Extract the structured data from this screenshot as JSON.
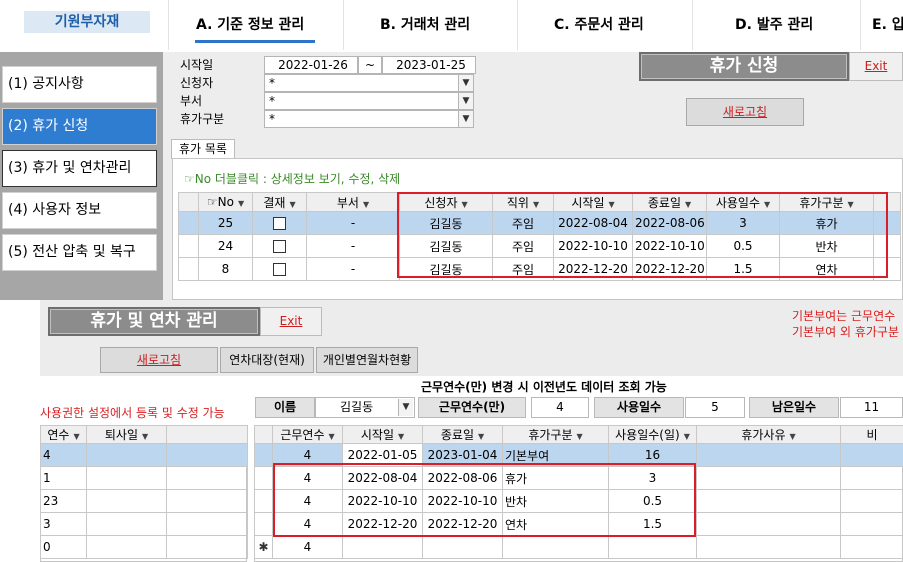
{
  "topnav": {
    "logo": "기원부자재",
    "tabs": [
      {
        "label": "A. 기준 정보 관리"
      },
      {
        "label": "B. 거래처 관리"
      },
      {
        "label": "C. 주문서 관리"
      },
      {
        "label": "D. 발주 관리"
      },
      {
        "label": "E. 입"
      }
    ]
  },
  "sidebar": {
    "items": [
      {
        "label": "(1) 공지사항"
      },
      {
        "label": "(2) 휴가 신청"
      },
      {
        "label": "(3) 휴가 및 연차관리"
      },
      {
        "label": "(4) 사용자 정보"
      },
      {
        "label": "(5) 전산 압축 및 복구"
      }
    ]
  },
  "leave_request": {
    "title": "휴가 신청",
    "exit_label": "Exit",
    "refresh_label": "새로고침",
    "filters": {
      "start_label": "시작일",
      "date_from": "2022-01-26",
      "date_sep": "~",
      "date_to": "2023-01-25",
      "applicant_label": "신청자",
      "applicant_value": "*",
      "dept_label": "부서",
      "dept_value": "*",
      "leave_type_label": "휴가구분",
      "leave_type_value": "*"
    },
    "tab_label": "휴가 목록",
    "hint": "☞No 더블클릭 : 상세정보 보기, 수정, 삭제",
    "columns": [
      "☞No",
      "결재",
      "부서",
      "신청자",
      "직위",
      "시작일",
      "종료일",
      "사용일수",
      "휴가구분"
    ],
    "rows": [
      {
        "no": "25",
        "approval": "",
        "dept": "-",
        "applicant": "김길동",
        "position": "주임",
        "start": "2022-08-04",
        "end": "2022-08-06",
        "days": "3",
        "type": "휴가"
      },
      {
        "no": "24",
        "approval": "",
        "dept": "-",
        "applicant": "김길동",
        "position": "주임",
        "start": "2022-10-10",
        "end": "2022-10-10",
        "days": "0.5",
        "type": "반차"
      },
      {
        "no": "8",
        "approval": "",
        "dept": "-",
        "applicant": "김길동",
        "position": "주임",
        "start": "2022-12-20",
        "end": "2022-12-20",
        "days": "1.5",
        "type": "연차"
      }
    ]
  },
  "leave_mgmt": {
    "title": "휴가 및 연차 관리",
    "exit_label": "Exit",
    "refresh_label": "새로고침",
    "ledger_label": "연차대장(현재)",
    "personal_label": "개인별연월차현황",
    "note_right_1": "기본부여는 근무연수",
    "note_right_2": "기본부여 외 휴가구분",
    "note_center": "근무연수(만) 변경 시 이전년도 데이터 조회 가능",
    "note_left": "사용권한 설정에서 등록 및 수정 가능",
    "name_label": "이름",
    "name_value": "김길동",
    "years_label": "근무연수(만)",
    "years_value": "4",
    "used_label": "사용일수",
    "used_value": "5",
    "remain_label": "남은일수",
    "remain_value": "11",
    "left_columns": [
      "연수",
      "퇴사일"
    ],
    "left_rows": [
      {
        "years": "4",
        "retire": ""
      },
      {
        "years": "1",
        "retire": ""
      },
      {
        "years": "23",
        "retire": ""
      },
      {
        "years": "3",
        "retire": ""
      },
      {
        "years": "0",
        "retire": ""
      }
    ],
    "right_columns": [
      "근무연수",
      "시작일",
      "종료일",
      "휴가구분",
      "사용일수(일)",
      "휴가사유",
      "비"
    ],
    "right_rows": [
      {
        "years": "4",
        "start": "2022-01-05",
        "end": "2023-01-04",
        "type": "기본부여",
        "days": "16",
        "reason": ""
      },
      {
        "years": "4",
        "start": "2022-08-04",
        "end": "2022-08-06",
        "type": "휴가",
        "days": "3",
        "reason": ""
      },
      {
        "years": "4",
        "start": "2022-10-10",
        "end": "2022-10-10",
        "type": "반차",
        "days": "0.5",
        "reason": ""
      },
      {
        "years": "4",
        "start": "2022-12-20",
        "end": "2022-12-20",
        "type": "연차",
        "days": "1.5",
        "reason": ""
      }
    ],
    "new_row_marker": "✱",
    "new_row_years": "4"
  },
  "colors": {
    "accent": "#2e7dd1",
    "highlight": "#d91e2a",
    "selected_row": "#bcd6ef"
  }
}
